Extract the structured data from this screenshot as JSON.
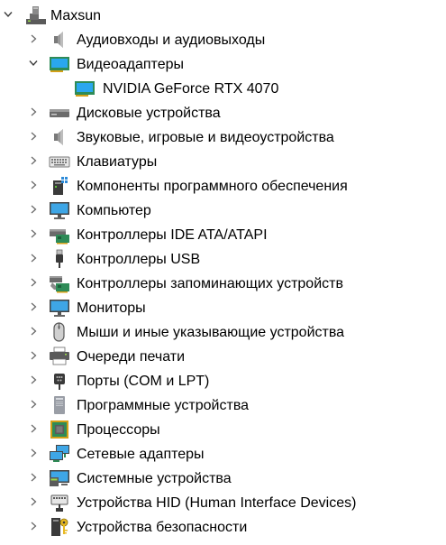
{
  "tree": {
    "root": {
      "label": "Maxsun",
      "icon": "computer-tower-icon",
      "expanded": true
    },
    "categories": [
      {
        "id": "audio-io",
        "label": "Аудиовходы и аудиовыходы",
        "icon": "speaker-icon",
        "expanded": false
      },
      {
        "id": "display-adapters",
        "label": "Видеоадаптеры",
        "icon": "display-adapter-icon",
        "expanded": true,
        "children": [
          {
            "label": "NVIDIA GeForce RTX 4070",
            "icon": "display-adapter-icon"
          }
        ]
      },
      {
        "id": "disk-drives",
        "label": "Дисковые устройства",
        "icon": "disk-drive-icon",
        "expanded": false
      },
      {
        "id": "sound-devices",
        "label": "Звуковые, игровые и видеоустройства",
        "icon": "speaker-icon",
        "expanded": false
      },
      {
        "id": "keyboards",
        "label": "Клавиатуры",
        "icon": "keyboard-icon",
        "expanded": false
      },
      {
        "id": "software-components",
        "label": "Компоненты программного обеспечения",
        "icon": "software-component-icon",
        "expanded": false
      },
      {
        "id": "computer",
        "label": "Компьютер",
        "icon": "monitor-icon",
        "expanded": false
      },
      {
        "id": "ide-controllers",
        "label": "Контроллеры IDE ATA/ATAPI",
        "icon": "ide-controller-icon",
        "expanded": false
      },
      {
        "id": "usb-controllers",
        "label": "Контроллеры USB",
        "icon": "usb-plug-icon",
        "expanded": false
      },
      {
        "id": "storage-controllers",
        "label": "Контроллеры запоминающих устройств",
        "icon": "storage-controller-icon",
        "expanded": false
      },
      {
        "id": "monitors",
        "label": "Мониторы",
        "icon": "monitor-icon",
        "expanded": false
      },
      {
        "id": "mice",
        "label": "Мыши и иные указывающие устройства",
        "icon": "mouse-icon",
        "expanded": false
      },
      {
        "id": "print-queues",
        "label": "Очереди печати",
        "icon": "printer-icon",
        "expanded": false
      },
      {
        "id": "ports",
        "label": "Порты (COM и LPT)",
        "icon": "port-icon",
        "expanded": false
      },
      {
        "id": "software-devices",
        "label": "Программные устройства",
        "icon": "software-device-icon",
        "expanded": false
      },
      {
        "id": "processors",
        "label": "Процессоры",
        "icon": "processor-icon",
        "expanded": false
      },
      {
        "id": "network-adapters",
        "label": "Сетевые адаптеры",
        "icon": "network-adapter-icon",
        "expanded": false
      },
      {
        "id": "system-devices",
        "label": "Системные устройства",
        "icon": "system-device-icon",
        "expanded": false
      },
      {
        "id": "hid-devices",
        "label": "Устройства HID (Human Interface Devices)",
        "icon": "hid-device-icon",
        "expanded": false
      },
      {
        "id": "security-devices",
        "label": "Устройства безопасности",
        "icon": "security-key-icon",
        "expanded": false
      }
    ]
  }
}
